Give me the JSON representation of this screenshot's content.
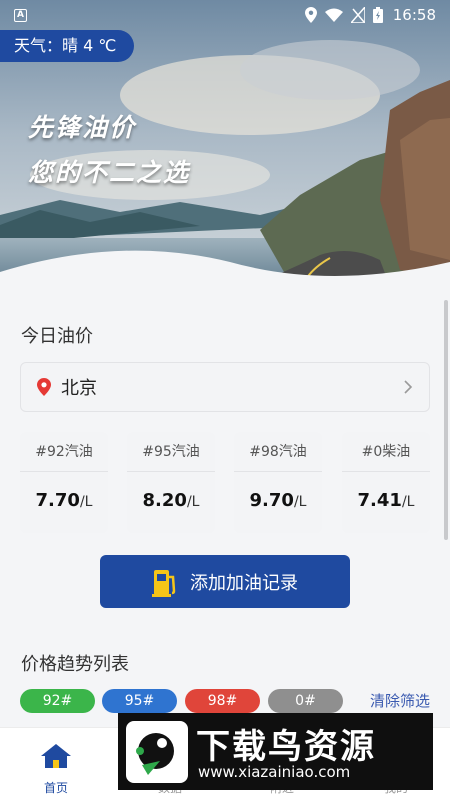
{
  "status_bar": {
    "time": "16:58",
    "left_icon": "A"
  },
  "hero": {
    "weather": "天气：晴 4 ℃",
    "slogan_line1": "先锋油价",
    "slogan_line2": "您的不二之选"
  },
  "today": {
    "title": "今日油价",
    "city": "北京",
    "prices": [
      {
        "label": "#92汽油",
        "value": "7.70",
        "unit": "/L"
      },
      {
        "label": "#95汽油",
        "value": "8.20",
        "unit": "/L"
      },
      {
        "label": "#98汽油",
        "value": "9.70",
        "unit": "/L"
      },
      {
        "label": "#0柴油",
        "value": "7.41",
        "unit": "/L"
      }
    ],
    "add_button": "添加加油记录"
  },
  "trend": {
    "title": "价格趋势列表",
    "chips": [
      {
        "label": "92#",
        "color": "#3bb54a"
      },
      {
        "label": "95#",
        "color": "#2f74d0"
      },
      {
        "label": "98#",
        "color": "#e0453a"
      },
      {
        "label": "0#",
        "color": "#8f8f8f"
      }
    ],
    "clear": "清除筛选"
  },
  "tabs": [
    {
      "label": "首页"
    },
    {
      "label": "数据"
    },
    {
      "label": "附近"
    },
    {
      "label": "我的"
    }
  ],
  "watermark": {
    "title": "下载鸟资源",
    "url": "www.xiazainiao.com"
  },
  "colors": {
    "primary": "#1f4aa0"
  }
}
